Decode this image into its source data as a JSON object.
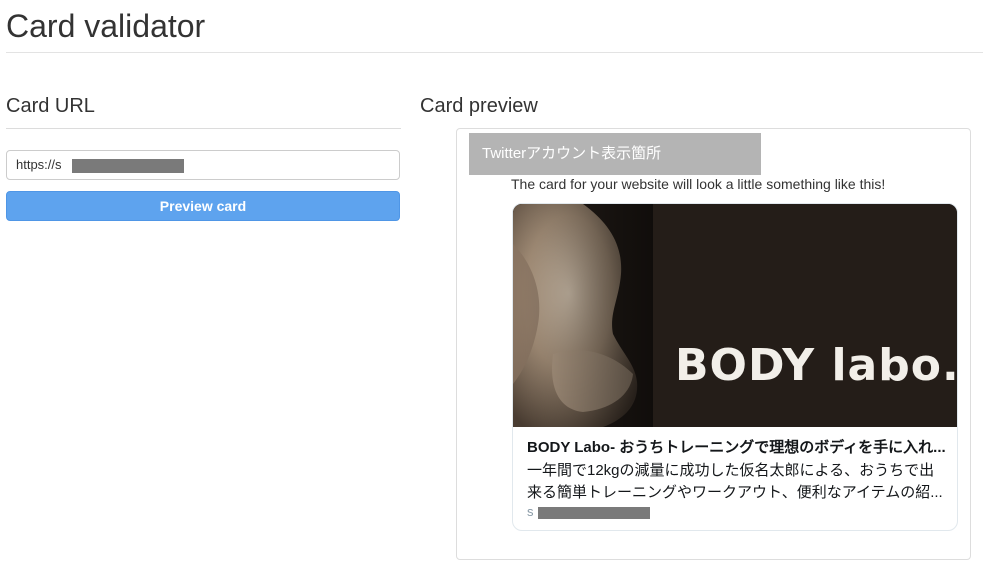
{
  "page": {
    "title": "Card validator"
  },
  "left": {
    "heading": "Card URL",
    "url_value": "https://s",
    "preview_button": "Preview card"
  },
  "right": {
    "heading": "Card preview",
    "account_overlay": "Twitterアカウント表示箇所",
    "tweet_text": "The card for your website will look a little something like this!",
    "card": {
      "image_text": "BODY labo.",
      "title": "BODY Labo- おうちトレーニングで理想のボディを手に入れ...",
      "description": "一年間で12kgの減量に成功した仮名太郎による、おうちで出来る簡単トレーニングやワークアウト、便利なアイテムの紹...",
      "domain": "s"
    }
  },
  "colors": {
    "button": "#5ea3ee",
    "overlay": "#b4b4b4",
    "redaction": "#7a7a7a",
    "card_border": "#e1e8ed",
    "domain_text": "#8899a6"
  }
}
